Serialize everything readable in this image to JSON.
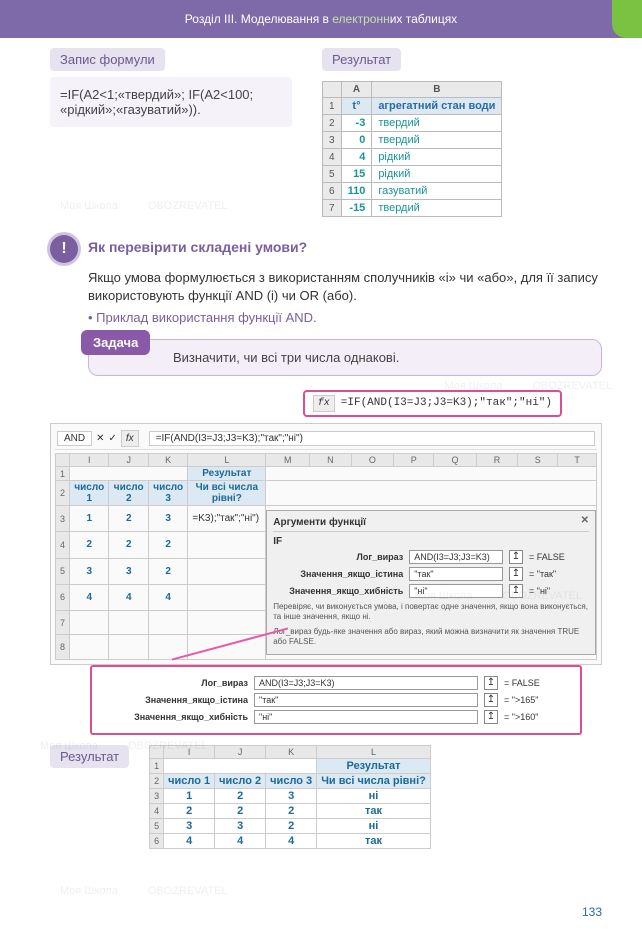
{
  "chapter": {
    "prefix": "Розділ III. Моделювання в ",
    "highlight": "електронн",
    "suffix": "их таблицях"
  },
  "sec1": {
    "label_formula": "Запис формули",
    "label_result": "Результат"
  },
  "formula_text": "=IF(A2<1;«твердий»; IF(A2<100; «рідкий»;«газуватий»)).",
  "result_table": {
    "cols": [
      "A",
      "B"
    ],
    "header": {
      "a": "t°",
      "b": "агрегатний стан води"
    },
    "rows": [
      {
        "n": "1",
        "a": "",
        "b": ""
      },
      {
        "n": "2",
        "a": "-3",
        "b": "твердий"
      },
      {
        "n": "3",
        "a": "0",
        "b": "твердий"
      },
      {
        "n": "4",
        "a": "4",
        "b": "рідкий"
      },
      {
        "n": "5",
        "a": "15",
        "b": "рідкий"
      },
      {
        "n": "6",
        "a": "110",
        "b": "газуватий"
      },
      {
        "n": "7",
        "a": "-15",
        "b": "твердий"
      }
    ]
  },
  "qmark": "!",
  "q_title": "Як перевірити складені умови?",
  "q_body": "Якщо умова формулюється з використанням сполучників «і» чи «або», для її запису використовують функції AND (і) чи OR (або).",
  "bullet_and": "Приклад використання функції AND.",
  "task": {
    "badge": "Задача",
    "text": "Визначити, чи всі три числа однакові."
  },
  "fx_callout": {
    "label": "fx",
    "formula": "=IF(AND(I3=J3;J3=K3);\"так\";\"ні\")"
  },
  "excel1": {
    "fxbar": {
      "cell": "AND",
      "formula": "=IF(AND(I3=J3;J3=K3);\"так\";\"ні\")"
    },
    "cols": [
      "",
      "I",
      "J",
      "K",
      "L",
      "M",
      "N",
      "O",
      "P",
      "Q",
      "R",
      "S",
      "T"
    ],
    "hdr1": "Результат",
    "hdr2": [
      "число 1",
      "число 2",
      "число 3",
      "Чи всі числа рівні?"
    ],
    "rows": [
      {
        "n": "3",
        "i": "1",
        "j": "2",
        "k": "3",
        "l": "=K3);\"так\";\"ні\")"
      },
      {
        "n": "4",
        "i": "2",
        "j": "2",
        "k": "2",
        "l": ""
      },
      {
        "n": "5",
        "i": "3",
        "j": "3",
        "k": "2",
        "l": ""
      },
      {
        "n": "6",
        "i": "4",
        "j": "4",
        "k": "4",
        "l": ""
      }
    ]
  },
  "args_dialog": {
    "title": "Аргументи функції",
    "fname": "IF",
    "rows": [
      {
        "lbl": "Лог_вираз",
        "val": "AND(I3=J3;J3=K3)",
        "res": "= FALSE"
      },
      {
        "lbl": "Значення_якщо_істина",
        "val": "\"так\"",
        "res": "= \"так\""
      },
      {
        "lbl": "Значення_якщо_хибність",
        "val": "\"ні\"",
        "res": "= \"ні\""
      }
    ],
    "hint1": "Перевіряє, чи виконується умова, і повертає одне значення, якщо вона виконується, та інше значення, якщо ні.",
    "hint2": "Лог_вираз    будь-яке значення або вираз, який можна визначити як значення TRUE або FALSE."
  },
  "zoom": {
    "rows": [
      {
        "lbl": "Лог_вираз",
        "val": "AND(I3=J3;J3=K3)",
        "res": "= FALSE"
      },
      {
        "lbl": "Значення_якщо_істина",
        "val": "\"так\"",
        "res": "= \">165\""
      },
      {
        "lbl": "Значення_якщо_хибність",
        "val": "\"ні\"",
        "res": "= \">160\""
      }
    ]
  },
  "result2": {
    "label": "Результат",
    "cols": [
      "",
      "I",
      "J",
      "K",
      "L"
    ],
    "hdr1": "Результат",
    "hdr2": [
      "число 1",
      "число 2",
      "число 3",
      "Чи всі числа рівні?"
    ],
    "rows": [
      {
        "n": "3",
        "i": "1",
        "j": "2",
        "k": "3",
        "l": "ні"
      },
      {
        "n": "4",
        "i": "2",
        "j": "2",
        "k": "2",
        "l": "так"
      },
      {
        "n": "5",
        "i": "3",
        "j": "3",
        "k": "2",
        "l": "ні"
      },
      {
        "n": "6",
        "i": "4",
        "j": "4",
        "k": "4",
        "l": "так"
      }
    ]
  },
  "pagenum": "133",
  "watermark": {
    "a": "Моя Школа",
    "b": "OBOZREVATEL"
  }
}
